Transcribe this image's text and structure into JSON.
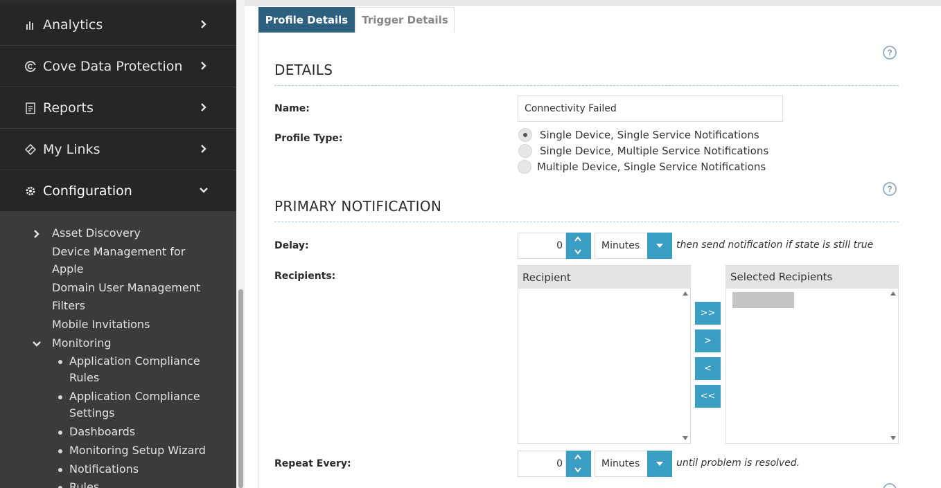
{
  "sidebar": {
    "nav": [
      {
        "label": "Analytics",
        "icon": "bar-chart-icon"
      },
      {
        "label": "Cove Data Protection",
        "icon": "cove-icon"
      },
      {
        "label": "Reports",
        "icon": "report-icon"
      },
      {
        "label": "My Links",
        "icon": "link-icon"
      },
      {
        "label": "Configuration",
        "icon": "gear-icon"
      }
    ],
    "submenu": {
      "asset_discovery": "Asset Discovery",
      "device_mgmt_line1": "Device Management for",
      "device_mgmt_line2": "Apple",
      "domain_user_mgmt": "Domain User Management",
      "filters": "Filters",
      "mobile_invitations": "Mobile Invitations",
      "monitoring": "Monitoring",
      "monitoring_items": {
        "app_rules_line1": "Application Compliance",
        "app_rules_line2": "Rules",
        "app_settings_line1": "Application Compliance",
        "app_settings_line2": "Settings",
        "dashboards": "Dashboards",
        "wizard": "Monitoring Setup Wizard",
        "notifications": "Notifications",
        "rules": "Rules"
      }
    }
  },
  "tabs": {
    "profile": "Profile Details",
    "trigger": "Trigger Details"
  },
  "details": {
    "title": "DETAILS",
    "name_label": "Name:",
    "name_value": "Connectivity Failed",
    "profile_type_label": "Profile Type:",
    "profile_types": [
      "Single Device, Single Service Notifications",
      "Single Device, Multiple Service Notifications",
      "Multiple Device, Single Service Notifications"
    ],
    "selected_profile_type": 0
  },
  "primary": {
    "title": "PRIMARY NOTIFICATION",
    "delay_label": "Delay:",
    "delay_value": "0",
    "delay_unit": "Minutes",
    "delay_hint": "then send notification if state is still true",
    "recipients_label": "Recipients:",
    "recipient_header": "Recipient",
    "selected_header": "Selected Recipients",
    "move_all_right": ">>",
    "move_right": ">",
    "move_left": "<",
    "move_all_left": "<<",
    "repeat_label": "Repeat Every:",
    "repeat_value": "0",
    "repeat_unit": "Minutes",
    "repeat_hint": "until problem is resolved."
  },
  "help_glyph": "?",
  "colors": {
    "sidebar_bg": "#3b3b3b",
    "nav_bg": "#262626",
    "tab_active": "#2d5f7e",
    "accent_button": "#3a9dc3"
  }
}
